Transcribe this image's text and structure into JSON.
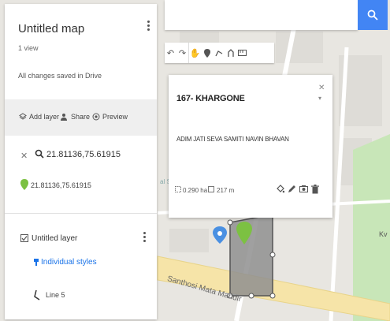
{
  "panel": {
    "title": "Untitled map",
    "views": "1 view",
    "saved": "All changes saved in Drive",
    "toolbar": {
      "add_layer": "Add layer",
      "share": "Share",
      "preview": "Preview"
    },
    "search_result": {
      "query": "21.81136,75.61915",
      "coordinate": "21.81136,75.61915"
    },
    "layer": {
      "name": "Untitled layer",
      "styles_label": "Individual styles",
      "item_label": "Line 5"
    }
  },
  "card": {
    "title": "167- KHARGONE",
    "description": "ADIM JATI SEVA SAMITI NAVIN BHAVAN",
    "area": "0.290 ha",
    "length": "217 m"
  },
  "map_labels": {
    "road": "Santhosi Mata Mandir",
    "right": "Kv",
    "edge": "al S"
  },
  "colors": {
    "search_button": "#4285f4",
    "link": "#1a73e8",
    "pin": "#7cc142",
    "polygon": "#8f8f8f",
    "park": "#c8e6b8",
    "road_yellow": "#f6e4a8"
  }
}
